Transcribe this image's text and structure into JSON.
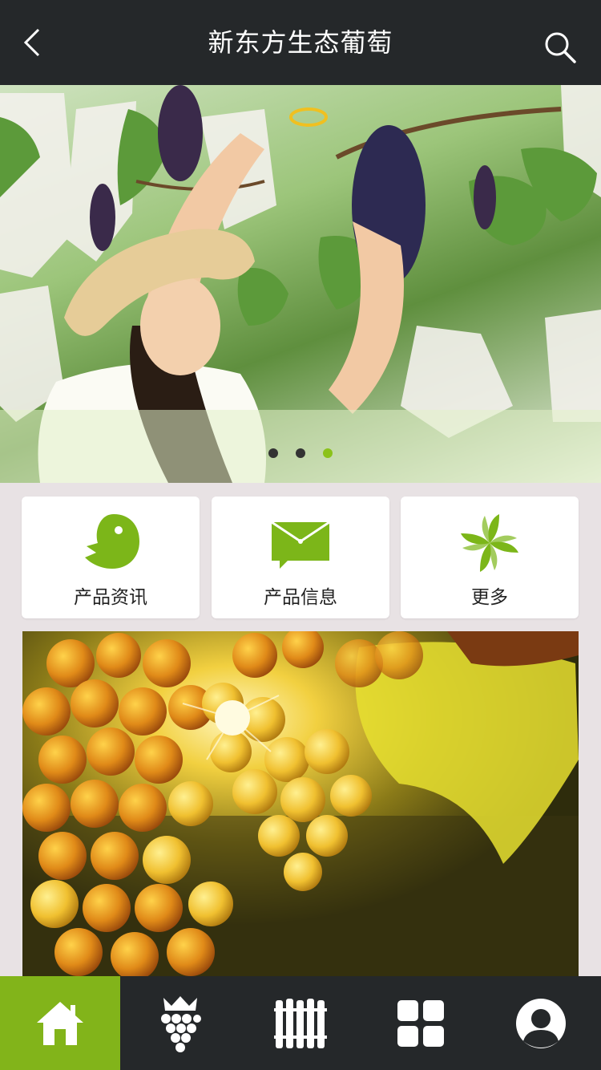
{
  "header": {
    "title": "新东方生态葡萄",
    "back_icon": "chevron-left-icon",
    "search_icon": "search-icon"
  },
  "banner": {
    "slide_count": 3,
    "active_slide": 3
  },
  "quick_menu": [
    {
      "label": "产品资讯",
      "icon": "bird-icon"
    },
    {
      "label": "产品信息",
      "icon": "envelope-icon"
    },
    {
      "label": "更多",
      "icon": "pinwheel-icon"
    }
  ],
  "bottom_nav": [
    {
      "icon": "home-icon",
      "active": true
    },
    {
      "icon": "crown-grapes-icon",
      "active": false
    },
    {
      "icon": "barrels-icon",
      "active": false
    },
    {
      "icon": "grid-icon",
      "active": false
    },
    {
      "icon": "user-icon",
      "active": false
    }
  ],
  "colors": {
    "accent": "#82b41a",
    "bar": "#25282a",
    "page_bg": "#e8e2e4",
    "icon_green": "#7cb619"
  }
}
